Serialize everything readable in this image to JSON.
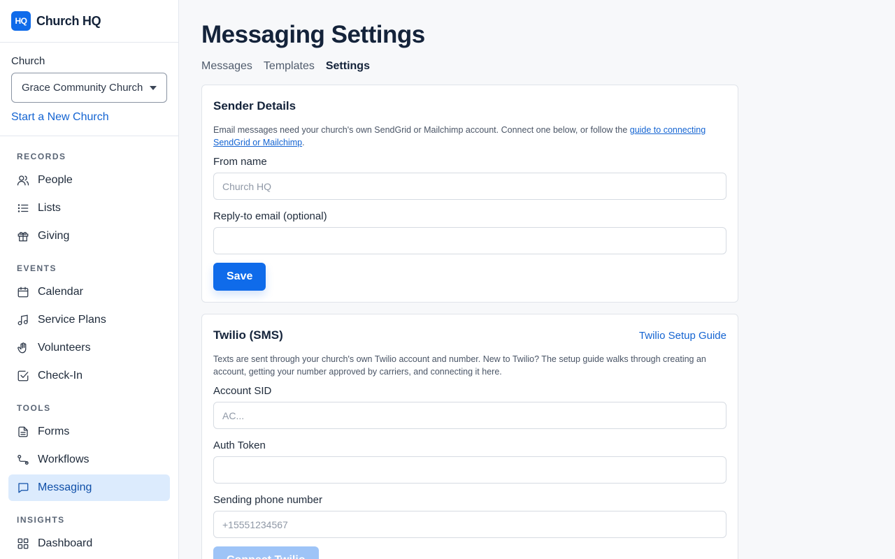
{
  "brand": {
    "logo_text": "HQ",
    "name": "Church HQ"
  },
  "church_picker": {
    "label": "Church",
    "selected": "Grace Community Church",
    "new_church_link": "Start a New Church"
  },
  "nav": {
    "sections": {
      "records": "RECORDS",
      "events": "EVENTS",
      "tools": "TOOLS",
      "insights": "INSIGHTS"
    },
    "items": {
      "people": "People",
      "lists": "Lists",
      "giving": "Giving",
      "calendar": "Calendar",
      "service_plans": "Service Plans",
      "volunteers": "Volunteers",
      "check_in": "Check-In",
      "forms": "Forms",
      "workflows": "Workflows",
      "messaging": "Messaging",
      "dashboard": "Dashboard"
    },
    "active": "messaging"
  },
  "page": {
    "title": "Messaging Settings",
    "tabs": [
      "Messages",
      "Templates",
      "Settings"
    ],
    "active_tab": "Settings"
  },
  "sender": {
    "title": "Sender Details",
    "desc_before": "Email messages need your church's own SendGrid or Mailchimp account. Connect one below, or follow the ",
    "desc_link": "guide to connecting SendGrid or Mailchimp",
    "desc_after": ".",
    "from_label": "From name",
    "from_placeholder": "Church HQ",
    "from_value": "",
    "reply_label": "Reply-to email (optional)",
    "reply_placeholder": "",
    "save_label": "Save"
  },
  "twilio": {
    "title": "Twilio (SMS)",
    "guide_link": "Twilio Setup Guide",
    "desc": "Texts are sent through your church's own Twilio account and number. New to Twilio? The setup guide walks through creating an account, getting your number approved by carriers, and connecting it here.",
    "sid_label": "Account SID",
    "sid_placeholder": "AC...",
    "token_label": "Auth Token",
    "token_placeholder": "",
    "phone_label": "Sending phone number",
    "phone_placeholder": "+15551234567",
    "connect_label": "Connect Twilio"
  },
  "colors": {
    "accent": "#0f6bea",
    "link": "#1464d2",
    "active_nav_bg": "#dcebfd"
  }
}
